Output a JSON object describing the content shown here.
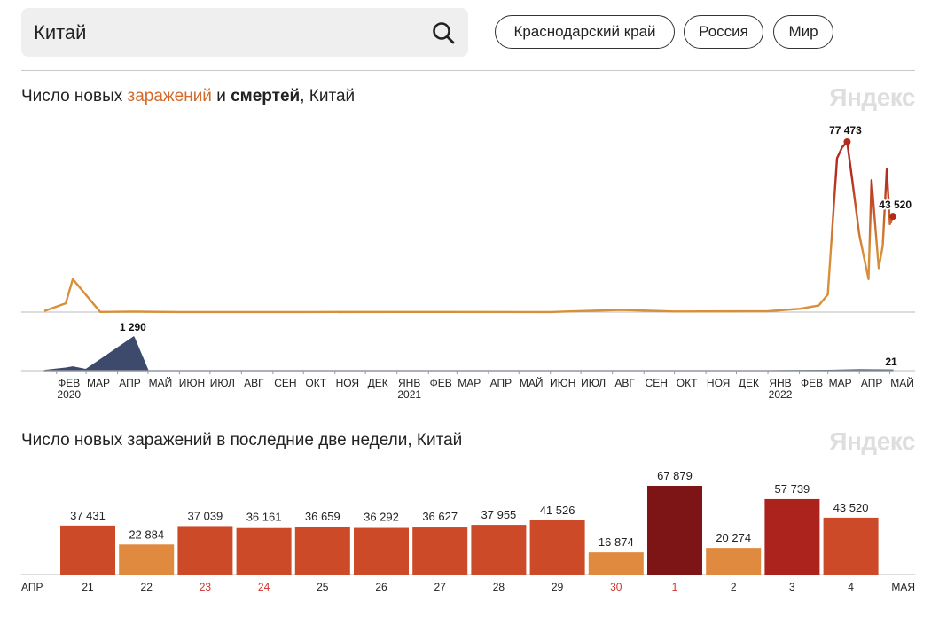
{
  "search": {
    "value": "Китай"
  },
  "region_chips": [
    "Краснодарский край",
    "Россия",
    "Мир"
  ],
  "brand": "Яндекс",
  "colors": {
    "cases": "#d88f3a",
    "cases_peak": "#b32c1e",
    "deaths": "#3d4a6b",
    "accent": "#d4692a"
  },
  "timeline": {
    "title_parts": [
      "Число новых ",
      "заражений",
      " и ",
      "смертей",
      ", Китай"
    ],
    "month_labels": [
      "ФЕВ",
      "МАР",
      "АПР",
      "МАЙ",
      "ИЮН",
      "ИЮЛ",
      "АВГ",
      "СЕН",
      "ОКТ",
      "НОЯ",
      "ДЕК",
      "ЯНВ",
      "ФЕВ",
      "МАР",
      "АПР",
      "МАЙ",
      "ИЮН",
      "ИЮЛ",
      "АВГ",
      "СЕН",
      "ОКТ",
      "НОЯ",
      "ДЕК",
      "ЯНВ",
      "ФЕВ",
      "МАР",
      "АПР",
      "МАЙ"
    ],
    "year_labels": [
      "2020",
      "2021",
      "2022"
    ],
    "cases_peak_label": "77 473",
    "cases_last_label": "43 520",
    "deaths_peak_label": "1 290",
    "deaths_last_label": "21"
  },
  "chart_data": [
    {
      "type": "area",
      "title": "Число новых заражений и смертей, Китай",
      "x": [
        "2020-01-20",
        "2020-02-10",
        "2020-02-17",
        "2020-03-15",
        "2020-04-17",
        "2020-06-01",
        "2020-10-01",
        "2021-01-01",
        "2021-06-01",
        "2021-08-10",
        "2021-10-01",
        "2022-01-01",
        "2022-02-01",
        "2022-02-20",
        "2022-03-01",
        "2022-03-10",
        "2022-03-15",
        "2022-03-20",
        "2022-03-25",
        "2022-04-01",
        "2022-04-10",
        "2022-04-13",
        "2022-04-20",
        "2022-04-24",
        "2022-04-28",
        "2022-05-01",
        "2022-05-04"
      ],
      "series": [
        {
          "values": [
            500,
            4000,
            15000,
            100,
            200,
            50,
            50,
            100,
            50,
            1000,
            300,
            400,
            1500,
            3000,
            8000,
            70000,
            75000,
            77473,
            60000,
            35000,
            15000,
            60000,
            20000,
            30000,
            65000,
            40000,
            43520
          ]
        }
      ],
      "annotations": [
        "77 473",
        "43 520"
      ]
    },
    {
      "type": "area",
      "x": [
        "2020-01-20",
        "2020-02-10",
        "2020-02-17",
        "2020-03-01",
        "2020-04-17",
        "2020-05-01",
        "2021-01-01",
        "2022-01-01",
        "2022-03-01",
        "2022-04-01",
        "2022-05-04"
      ],
      "series": [
        {
          "values": [
            2,
            90,
            140,
            40,
            1290,
            0,
            0,
            0,
            6,
            30,
            21
          ]
        }
      ],
      "annotations": [
        "1 290",
        "21"
      ]
    },
    {
      "type": "bar",
      "title": "Число новых заражений в последние две недели, Китай",
      "categories": [
        "21",
        "22",
        "23",
        "24",
        "25",
        "26",
        "27",
        "28",
        "29",
        "30",
        "1",
        "2",
        "3",
        "4"
      ],
      "values": [
        37431,
        22884,
        37039,
        36161,
        36659,
        36292,
        36627,
        37955,
        41526,
        16874,
        67879,
        20274,
        57739,
        43520
      ],
      "value_labels": [
        "37 431",
        "22 884",
        "37 039",
        "36 161",
        "36 659",
        "36 292",
        "36 627",
        "37 955",
        "41 526",
        "16 874",
        "67 879",
        "20 274",
        "57 739",
        "43 520"
      ],
      "axis_start_label": "АПР",
      "axis_end_label": "МАЯ",
      "holiday_categories": [
        "23",
        "24",
        "30",
        "1"
      ]
    }
  ]
}
